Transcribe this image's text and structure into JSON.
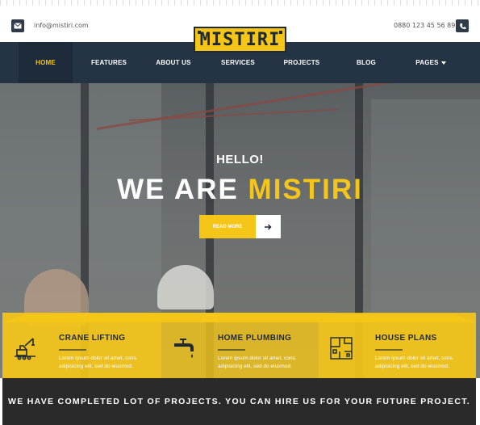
{
  "topbar": {
    "email": "info@mistiri.com",
    "phone": "0880 123 45 56 89",
    "email_icon": "envelope-icon",
    "phone_icon": "phone-icon"
  },
  "brand": {
    "logo_text": "MISTIRI"
  },
  "nav": {
    "items": [
      {
        "label": "HOME",
        "active": true
      },
      {
        "label": "FEATURES"
      },
      {
        "label": "ABOUT US"
      },
      {
        "label": "SERVICES"
      },
      {
        "label": "PROJECTS"
      },
      {
        "label": "BLOG"
      },
      {
        "label": "PAGES",
        "dropdown": true
      }
    ]
  },
  "hero": {
    "greeting": "HELLO!",
    "headline_prefix": "WE ARE ",
    "headline_accent": "MISTIRI",
    "cta_label": "READ MORE",
    "cta_icon": "arrow-right-icon"
  },
  "features": [
    {
      "title": "CRANE LIFTING",
      "description": "Lorem ipsum dolor sit amet, cons. adipisicing elit, sed do eiusmod.",
      "icon": "crane-icon"
    },
    {
      "title": "HOME PLUMBING",
      "description": "Lorem ipsum dolor sit amet, cons. adipisicing elit, sed do eiusmod.",
      "icon": "faucet-icon"
    },
    {
      "title": "HOUSE PLANS",
      "description": "Lorem ipsum dolor sit amet, cons. adipisicing elit, sed do eiusmod.",
      "icon": "floor-plan-icon"
    }
  ],
  "footer_strip": {
    "text": "WE HAVE COMPLETED LOT OF PROJECTS. YOU CAN HIRE US FOR YOUR FUTURE PROJECT."
  },
  "colors": {
    "accent": "#f5c518",
    "nav_bg": "#253445",
    "dark": "#1f2a36",
    "strip_bg": "#2a2a2a"
  }
}
